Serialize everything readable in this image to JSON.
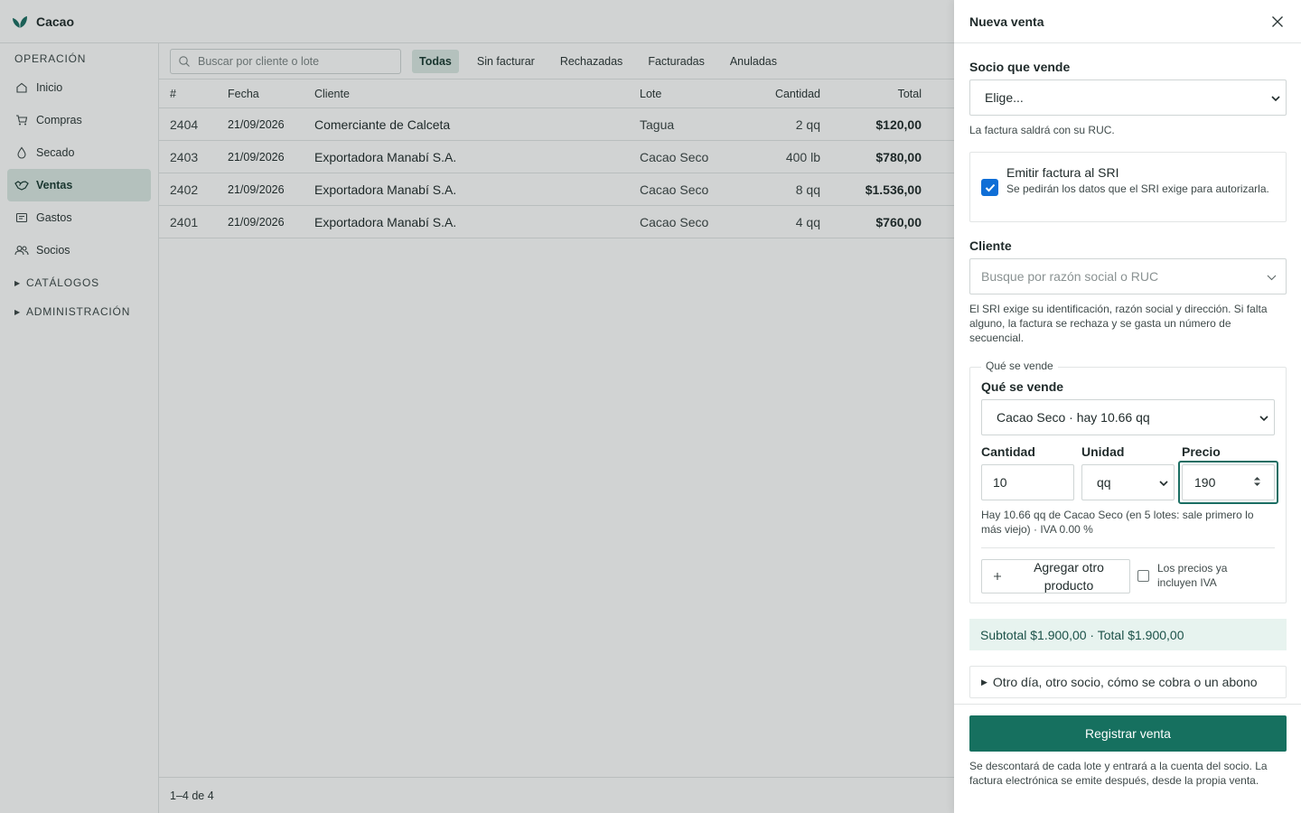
{
  "app": {
    "name": "Cacao"
  },
  "sidebar": {
    "section": "OPERACIÓN",
    "items": [
      {
        "label": "Inicio",
        "icon": "home-icon"
      },
      {
        "label": "Compras",
        "icon": "cart-icon"
      },
      {
        "label": "Secado",
        "icon": "drop-icon"
      },
      {
        "label": "Ventas",
        "icon": "handshake-icon",
        "active": true
      },
      {
        "label": "Gastos",
        "icon": "receipt-icon"
      },
      {
        "label": "Socios",
        "icon": "users-icon"
      }
    ],
    "groups": [
      {
        "label": "CATÁLOGOS"
      },
      {
        "label": "ADMINISTRACIÓN"
      }
    ]
  },
  "toolbar": {
    "search_placeholder": "Buscar por cliente o lote",
    "tabs": [
      {
        "label": "Todas",
        "active": true
      },
      {
        "label": "Sin facturar"
      },
      {
        "label": "Rechazadas"
      },
      {
        "label": "Facturadas"
      },
      {
        "label": "Anuladas"
      }
    ]
  },
  "table": {
    "headers": {
      "num": "#",
      "fecha": "Fecha",
      "cliente": "Cliente",
      "lote": "Lote",
      "cantidad": "Cantidad",
      "total": "Total"
    },
    "rows": [
      {
        "num": "2404",
        "fecha": "21/09/2026",
        "cliente": "Comerciante de Calceta",
        "lote": "Tagua",
        "cantidad": "2 qq",
        "total": "$120,00"
      },
      {
        "num": "2403",
        "fecha": "21/09/2026",
        "cliente": "Exportadora Manabí S.A.",
        "lote": "Cacao Seco",
        "cantidad": "400 lb",
        "total": "$780,00"
      },
      {
        "num": "2402",
        "fecha": "21/09/2026",
        "cliente": "Exportadora Manabí S.A.",
        "lote": "Cacao Seco",
        "cantidad": "8 qq",
        "total": "$1.536,00"
      },
      {
        "num": "2401",
        "fecha": "21/09/2026",
        "cliente": "Exportadora Manabí S.A.",
        "lote": "Cacao Seco",
        "cantidad": "4 qq",
        "total": "$760,00"
      }
    ]
  },
  "pager": {
    "text": "1–4 de 4"
  },
  "drawer": {
    "title": "Nueva venta",
    "socio": {
      "label": "Socio que vende",
      "value": "Elige...",
      "hint": "La factura saldrá con su RUC."
    },
    "sri": {
      "checked": true,
      "label": "Emitir factura al SRI",
      "hint": "Se pedirán los datos que el SRI exige para autorizarla."
    },
    "cliente": {
      "label": "Cliente",
      "placeholder": "Busque por razón social o RUC",
      "hint": "El SRI exige su identificación, razón social y dirección. Si falta alguno, la factura se rechaza y se gasta un número de secuencial."
    },
    "producto": {
      "legend": "Qué se vende",
      "label": "Qué se vende",
      "value": "Cacao Seco · hay 10.66 qq",
      "cantidad_label": "Cantidad",
      "cantidad_value": "10",
      "unidad_label": "Unidad",
      "unidad_value": "qq",
      "precio_label": "Precio",
      "precio_value": "190",
      "hint": "Hay 10.66 qq de Cacao Seco (en 5 lotes: sale primero lo más viejo) · IVA 0.00 %",
      "add_label": "Agregar otro producto",
      "iva_label": "Los precios ya incluyen IVA"
    },
    "summary": "Subtotal $1.900,00 · Total $1.900,00",
    "details_label": "Otro día, otro socio, cómo se cobra o un abono",
    "submit_label": "Registrar venta",
    "footer_hint": "Se descontará de cada lote y entrará a la cuenta del socio. La factura electrónica se emite después, desde la propia venta."
  },
  "colors": {
    "accent": "#16705f",
    "active_bg": "#dbe9e4",
    "checkbox": "#0f6ed6",
    "summary_bg": "#e7f3ef"
  }
}
